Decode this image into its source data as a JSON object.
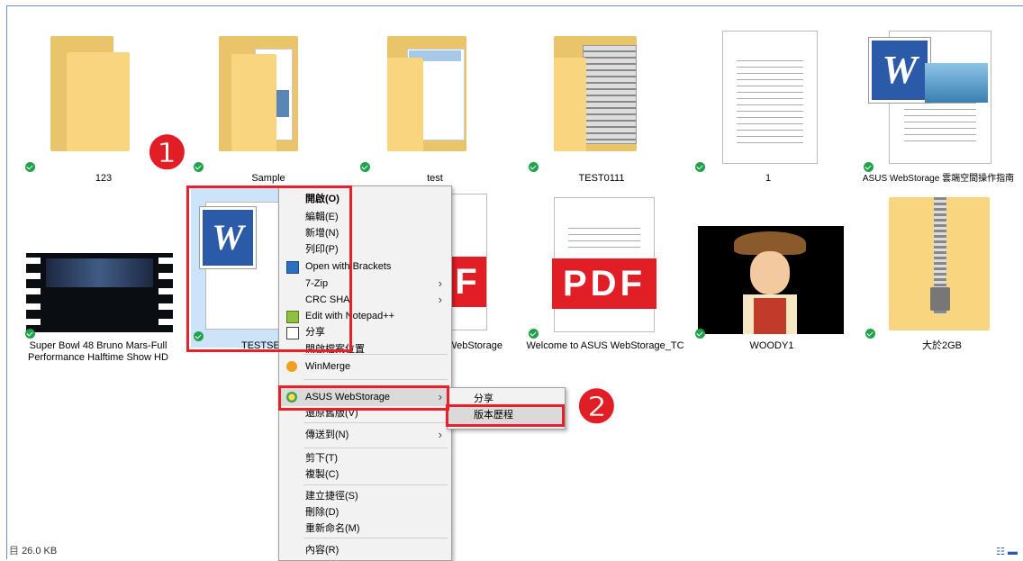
{
  "files": [
    {
      "name": "123",
      "kind": "folder"
    },
    {
      "name": "Sample",
      "kind": "folder"
    },
    {
      "name": "test",
      "kind": "folder"
    },
    {
      "name": "TEST0111",
      "kind": "folder"
    },
    {
      "name": "1",
      "kind": "document"
    },
    {
      "name": "ASUS WebStorage 雲端空間操作指南",
      "kind": "word"
    },
    {
      "name": "Super Bowl 48 Bruno Mars-Full Performance Halftime Show HD",
      "kind": "video"
    },
    {
      "name": "TESTSEA",
      "kind": "word"
    },
    {
      "name": "WebStorage",
      "kind": "pdf"
    },
    {
      "name": "Welcome to ASUS WebStorage_TC",
      "kind": "pdf"
    },
    {
      "name": "WOODY1",
      "kind": "image"
    },
    {
      "name": "大於2GB",
      "kind": "zip"
    }
  ],
  "pdf_label": "PDF",
  "pdf_partial_label": "F",
  "context_menu": {
    "items": [
      {
        "label": "開啟(O)",
        "bold": true
      },
      {
        "label": "編輯(E)"
      },
      {
        "label": "新增(N)"
      },
      {
        "label": "列印(P)"
      },
      {
        "label": "Open with Brackets",
        "icon": "brackets-icon"
      },
      {
        "label": "7-Zip",
        "submenu": true
      },
      {
        "label": "CRC SHA",
        "submenu": true
      },
      {
        "label": "Edit with Notepad++",
        "icon": "notepad-plus-plus-icon"
      },
      {
        "label": "分享",
        "icon": "share-icon"
      },
      {
        "label": "開啟檔案位置"
      },
      {
        "label": "WinMerge",
        "icon": "winmerge-icon"
      },
      {
        "label": "ASUS WebStorage",
        "icon": "asus-webstorage-icon",
        "submenu": true
      },
      {
        "label": "還原舊版(V)"
      },
      {
        "label": "傳送到(N)",
        "submenu": true
      },
      {
        "label": "剪下(T)"
      },
      {
        "label": "複製(C)"
      },
      {
        "label": "建立捷徑(S)"
      },
      {
        "label": "刪除(D)"
      },
      {
        "label": "重新命名(M)"
      },
      {
        "label": "內容(R)"
      }
    ]
  },
  "submenu": {
    "items": [
      {
        "label": "分享"
      },
      {
        "label": "版本歷程"
      }
    ]
  },
  "badges": {
    "one": "❶",
    "two": "❷"
  },
  "status": {
    "size": "26.0 KB"
  },
  "colors": {
    "highlight": "#e8202a",
    "check": "#1fa34a",
    "folder": "#f8d57e",
    "pdf": "#e11d26"
  }
}
